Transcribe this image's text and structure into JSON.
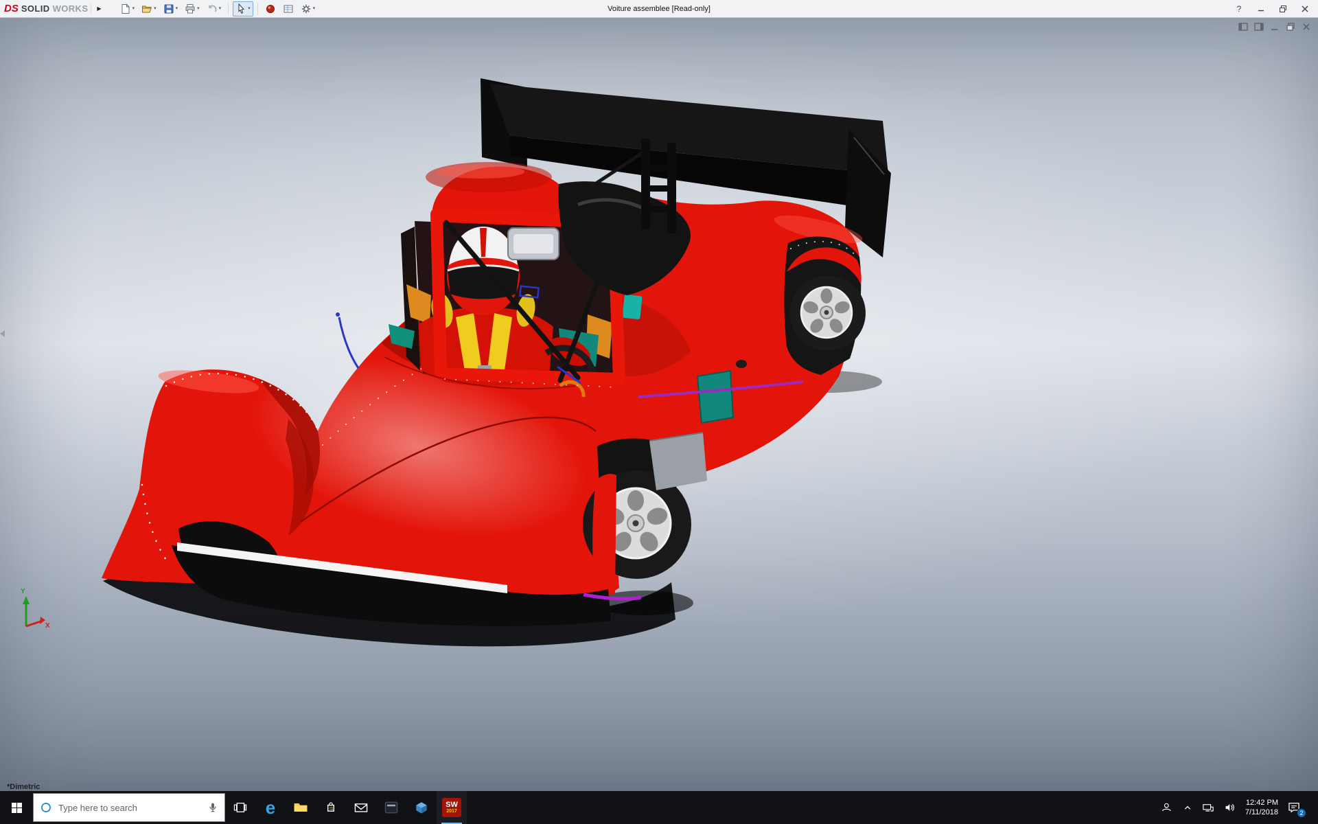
{
  "titlebar": {
    "ds": "DS",
    "word_solid": "SOLID",
    "word_works": "WORKS",
    "title": "Voiture assemblee [Read-only]"
  },
  "glyphs": {
    "flyout": "▶",
    "caret": "▾",
    "help": "?"
  },
  "toolbar": {
    "items": [
      "new-document",
      "open",
      "save",
      "print",
      "undo",
      "select",
      "appearance",
      "design-table",
      "options"
    ]
  },
  "doc_window_controls": [
    "dock-left",
    "dock-right",
    "minimize",
    "restore",
    "close"
  ],
  "viewport": {
    "view_label": "*Dimetric",
    "axis_x": "X",
    "axis_y": "Y"
  },
  "taskbar": {
    "search_placeholder": "Type here to search",
    "edge_glyph": "e",
    "sw_label": "SW",
    "sw_year": "2017",
    "time": "12:42 PM",
    "date": "7/11/2018",
    "badge_count": "2",
    "apps": [
      "start",
      "search",
      "task-view",
      "edge",
      "file-explorer",
      "store",
      "mail",
      "app-window",
      "3d-viewer",
      "solidworks"
    ],
    "tray": [
      "people",
      "hidden-icons",
      "network",
      "volume",
      "clock",
      "action-center"
    ]
  },
  "colors": {
    "car_red": "#e3150a",
    "car_red_dark": "#9c0b02",
    "car_red_deep": "#7c0801",
    "car_red_light": "#ff5b49",
    "wing_black": "#0c0c0c",
    "rim_silver": "#dcdcdc",
    "harness_yellow": "#efcc1e",
    "seat_teal": "#12877c",
    "accent_teal": "#17b3a9",
    "accent_orange": "#dd8a1e",
    "accent_magenta": "#9b2bbf",
    "stripe_white": "#f4f4f4",
    "helmet_white": "#f2f2f2",
    "sketch_blue": "#2936c8"
  }
}
